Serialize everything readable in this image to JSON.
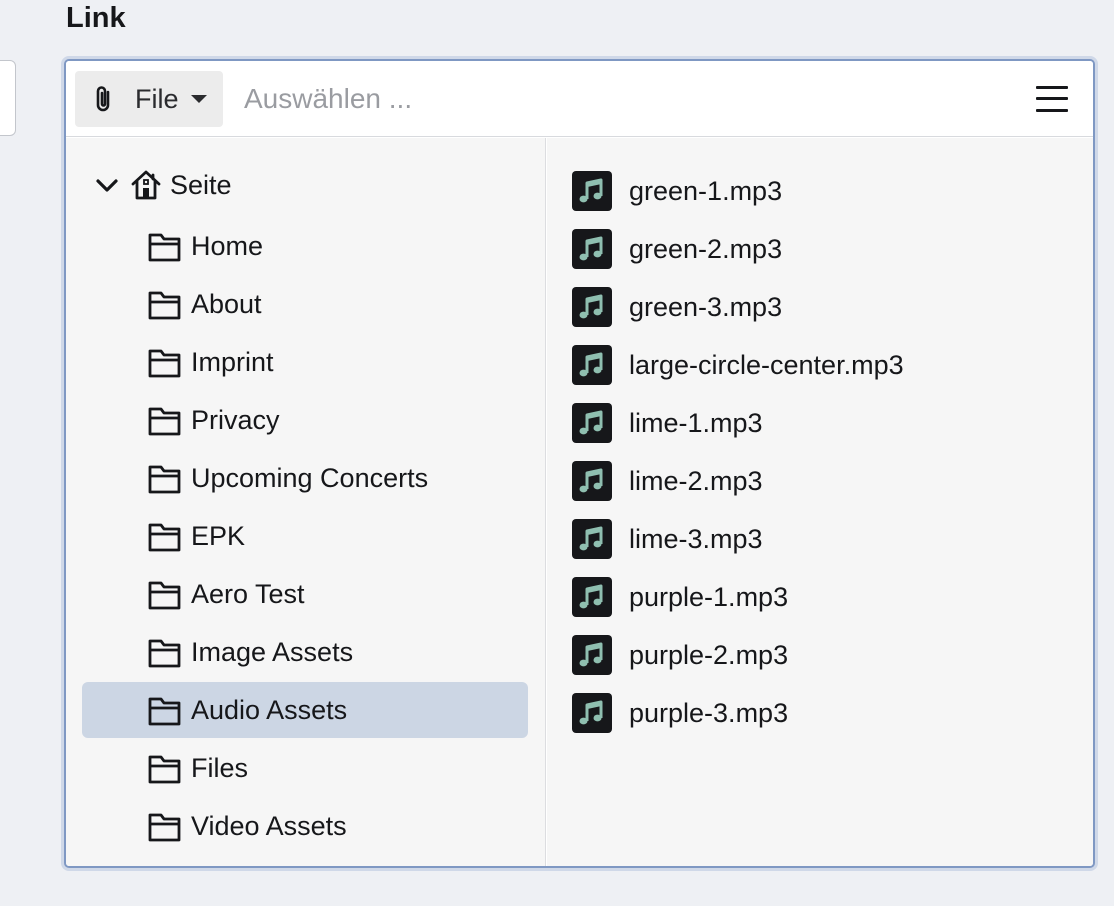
{
  "field": {
    "label": "Link"
  },
  "toolbar": {
    "type_label": "File",
    "type_icon": "paperclip-icon",
    "search_placeholder": "Auswählen ...",
    "search_value": "",
    "menu_icon": "hamburger-menu-icon"
  },
  "tree": {
    "root": {
      "label": "Seite",
      "icon": "home-icon",
      "expanded": true
    },
    "items": [
      {
        "label": "Home",
        "selected": false
      },
      {
        "label": "About",
        "selected": false
      },
      {
        "label": "Imprint",
        "selected": false
      },
      {
        "label": "Privacy",
        "selected": false
      },
      {
        "label": "Upcoming Concerts",
        "selected": false
      },
      {
        "label": "EPK",
        "selected": false
      },
      {
        "label": "Aero Test",
        "selected": false
      },
      {
        "label": "Image Assets",
        "selected": false
      },
      {
        "label": "Audio Assets",
        "selected": true
      },
      {
        "label": "Files",
        "selected": false
      },
      {
        "label": "Video Assets",
        "selected": false
      }
    ]
  },
  "files": {
    "items": [
      {
        "label": "green-1.mp3",
        "icon": "audio-file-icon"
      },
      {
        "label": "green-2.mp3",
        "icon": "audio-file-icon"
      },
      {
        "label": "green-3.mp3",
        "icon": "audio-file-icon"
      },
      {
        "label": "large-circle-center.mp3",
        "icon": "audio-file-icon"
      },
      {
        "label": "lime-1.mp3",
        "icon": "audio-file-icon"
      },
      {
        "label": "lime-2.mp3",
        "icon": "audio-file-icon"
      },
      {
        "label": "lime-3.mp3",
        "icon": "audio-file-icon"
      },
      {
        "label": "purple-1.mp3",
        "icon": "audio-file-icon"
      },
      {
        "label": "purple-2.mp3",
        "icon": "audio-file-icon"
      },
      {
        "label": "purple-3.mp3",
        "icon": "audio-file-icon"
      }
    ]
  },
  "colors": {
    "background": "#eef0f4",
    "panel_border": "#7f98c3",
    "selected_row": "#ccd6e4",
    "audio_icon_bg": "#16171a",
    "audio_icon_fg": "#8fbfb0"
  }
}
